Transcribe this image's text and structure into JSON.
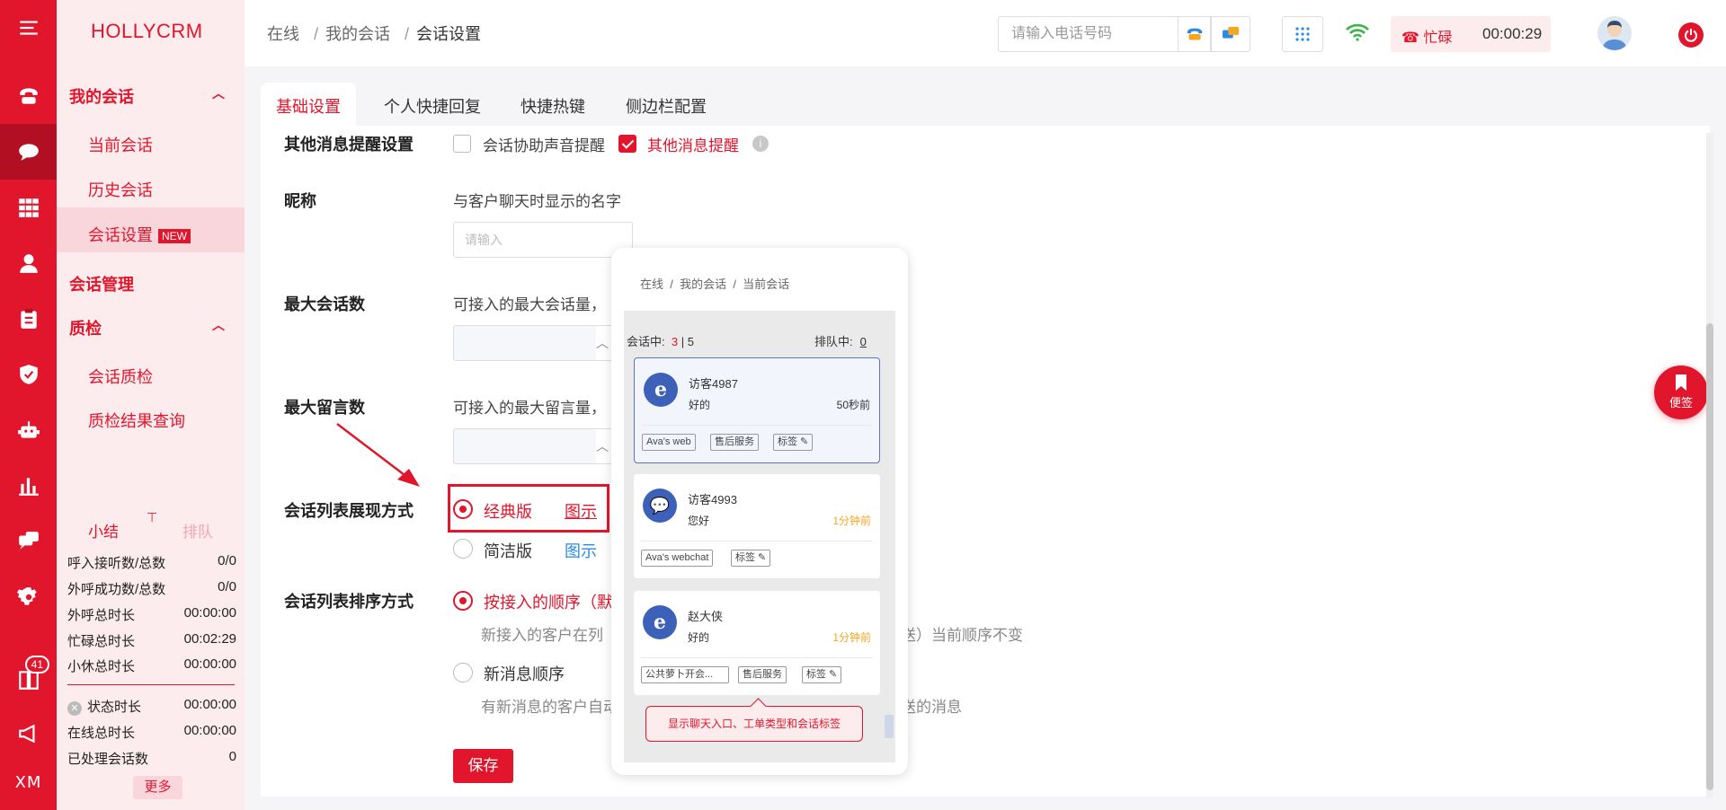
{
  "app": {
    "logo": "HOLLYCRM"
  },
  "rail": {
    "badge_count": "41",
    "footer_label": "XM"
  },
  "sidebar": {
    "group_my_session": "我的会话",
    "item_current": "当前会话",
    "item_history": "历史会话",
    "item_settings": "会话设置",
    "new_badge": "NEW",
    "group_session_mgmt": "会话管理",
    "group_qc": "质检",
    "item_qc": "会话质检",
    "item_qc_result": "质检结果查询",
    "stats_tab_summary": "小结",
    "stats_tab_queue": "排队",
    "stats": [
      {
        "label": "呼入接听数/总数",
        "value": "0/0"
      },
      {
        "label": "外呼成功数/总数",
        "value": "0/0"
      },
      {
        "label": "外呼总时长",
        "value": "00:00:00"
      },
      {
        "label": "忙碌总时长",
        "value": "00:02:29"
      },
      {
        "label": "小休总时长",
        "value": "00:00:00"
      }
    ],
    "stats2": [
      {
        "label": "状态时长",
        "value": "00:00:00"
      },
      {
        "label": "在线总时长",
        "value": "00:00:00"
      },
      {
        "label": "已处理会话数",
        "value": "0"
      }
    ],
    "more_label": "更多"
  },
  "topbar": {
    "breadcrumb": [
      "在线",
      "我的会话",
      "会话设置"
    ],
    "phone_placeholder": "请输入电话号码",
    "status_label": "忙碌",
    "status_time": "00:00:29"
  },
  "tabs": [
    "基础设置",
    "个人快捷回复",
    "快捷热键",
    "侧边栏配置"
  ],
  "form": {
    "other_msg_label": "其他消息提醒设置",
    "cb_assist_sound": "会话协助声音提醒",
    "cb_other_msg": "其他消息提醒",
    "nickname_label": "昵称",
    "nickname_desc": "与客户聊天时显示的名字",
    "nickname_placeholder": "请输入",
    "max_session_label": "最大会话数",
    "max_session_desc": "可接入的最大会话量，",
    "max_msg_label": "最大留言数",
    "max_msg_desc": "可接入的最大留言量，",
    "list_style_label": "会话列表展现方式",
    "style_classic": "经典版",
    "style_simple": "简洁版",
    "illustration": "图示",
    "sort_label": "会话列表排序方式",
    "sort_by_access": "按接入的顺序（默",
    "sort_by_access_hint_a": "新接入的客户在列",
    "sort_by_access_hint_b": "送）当前顺序不变",
    "sort_by_new_msg": "新消息顺序",
    "sort_by_new_msg_hint_a": "有新消息的客户自动",
    "sort_by_new_msg_hint_b": "送的消息",
    "save_label": "保存"
  },
  "preview": {
    "breadcrumb": [
      "在线",
      "我的会话",
      "当前会话"
    ],
    "in_session_label": "会话中:",
    "in_session_count": "3",
    "in_session_total": "5",
    "queue_label": "排队中:",
    "queue_count": "0",
    "cards": [
      {
        "name": "访客4987",
        "msg": "好的",
        "time": "50秒前",
        "tags": [
          "Ava's web",
          "售后服务",
          "标签"
        ]
      },
      {
        "name": "访客4993",
        "msg": "您好",
        "time": "1分钟前",
        "tags": [
          "Ava's webchat",
          "标签"
        ]
      },
      {
        "name": "赵大侠",
        "msg": "好的",
        "time": "1分钟前",
        "tags": [
          "公共萝卜开会...",
          "售后服务",
          "标签"
        ]
      }
    ],
    "tip": "显示聊天入口、工单类型和会话标签"
  },
  "float_note": {
    "label": "便签"
  },
  "colors": {
    "brand": "#e1162c",
    "link": "#2b8ae6",
    "time_orange": "#f5a623",
    "avatar_blue": "#3d61b8"
  },
  "icons": {
    "rail": [
      "menu-icon",
      "phone-icon",
      "chat-icon",
      "grid-icon",
      "user-icon",
      "clipboard-icon",
      "shield-icon",
      "robot-icon",
      "bar-chart-icon",
      "message-icon",
      "gear-icon",
      "book-icon",
      "megaphone-icon"
    ]
  }
}
